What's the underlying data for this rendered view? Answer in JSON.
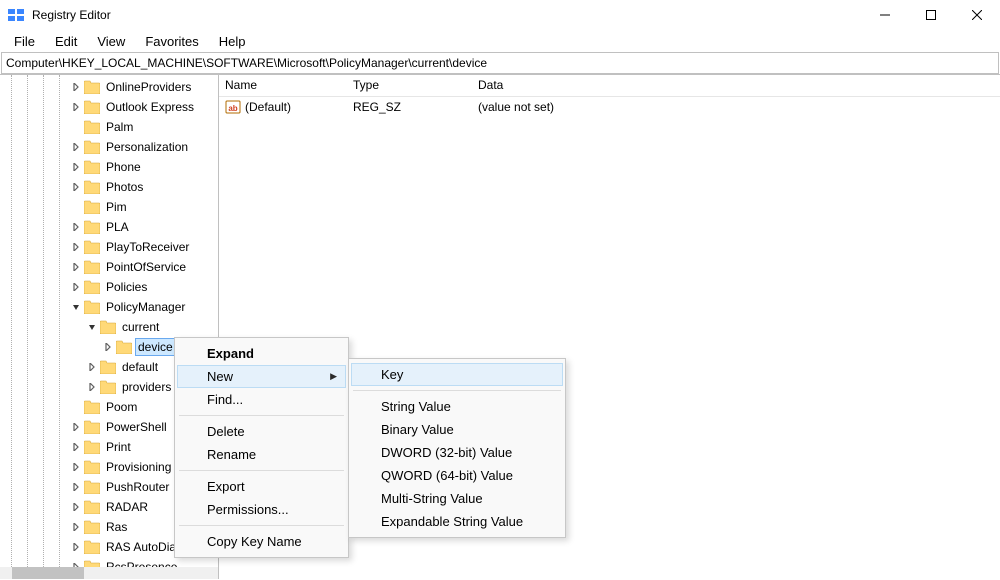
{
  "window": {
    "title": "Registry Editor"
  },
  "menu": {
    "file": "File",
    "edit": "Edit",
    "view": "View",
    "favorites": "Favorites",
    "help": "Help"
  },
  "address": "Computer\\HKEY_LOCAL_MACHINE\\SOFTWARE\\Microsoft\\PolicyManager\\current\\device",
  "list": {
    "columns": {
      "name": "Name",
      "type": "Type",
      "data": "Data"
    },
    "rows": [
      {
        "name": "(Default)",
        "type": "REG_SZ",
        "data": "(value not set)"
      }
    ]
  },
  "tree": {
    "items": [
      {
        "depth": 4,
        "label": "OnlineProviders",
        "tw": ">"
      },
      {
        "depth": 4,
        "label": "Outlook Express",
        "tw": ">"
      },
      {
        "depth": 4,
        "label": "Palm",
        "tw": ""
      },
      {
        "depth": 4,
        "label": "Personalization",
        "tw": ">"
      },
      {
        "depth": 4,
        "label": "Phone",
        "tw": ">"
      },
      {
        "depth": 4,
        "label": "Photos",
        "tw": ">"
      },
      {
        "depth": 4,
        "label": "Pim",
        "tw": ""
      },
      {
        "depth": 4,
        "label": "PLA",
        "tw": ">"
      },
      {
        "depth": 4,
        "label": "PlayToReceiver",
        "tw": ">"
      },
      {
        "depth": 4,
        "label": "PointOfService",
        "tw": ">"
      },
      {
        "depth": 4,
        "label": "Policies",
        "tw": ">"
      },
      {
        "depth": 4,
        "label": "PolicyManager",
        "tw": "v"
      },
      {
        "depth": 5,
        "label": "current",
        "tw": "v"
      },
      {
        "depth": 6,
        "label": "device",
        "tw": ">",
        "selected": true
      },
      {
        "depth": 5,
        "label": "default",
        "tw": ">"
      },
      {
        "depth": 5,
        "label": "providers",
        "tw": ">"
      },
      {
        "depth": 4,
        "label": "Poom",
        "tw": ""
      },
      {
        "depth": 4,
        "label": "PowerShell",
        "tw": ">"
      },
      {
        "depth": 4,
        "label": "Print",
        "tw": ">"
      },
      {
        "depth": 4,
        "label": "Provisioning",
        "tw": ">"
      },
      {
        "depth": 4,
        "label": "PushRouter",
        "tw": ">"
      },
      {
        "depth": 4,
        "label": "RADAR",
        "tw": ">"
      },
      {
        "depth": 4,
        "label": "Ras",
        "tw": ">"
      },
      {
        "depth": 4,
        "label": "RAS AutoDial",
        "tw": ">"
      },
      {
        "depth": 4,
        "label": "RcsPresence",
        "tw": ">"
      }
    ]
  },
  "context1": {
    "expand": "Expand",
    "new": "New",
    "find": "Find...",
    "delete": "Delete",
    "rename": "Rename",
    "export": "Export",
    "permissions": "Permissions...",
    "copy_key_name": "Copy Key Name"
  },
  "context2": {
    "key": "Key",
    "string_value": "String Value",
    "binary_value": "Binary Value",
    "dword_value": "DWORD (32-bit) Value",
    "qword_value": "QWORD (64-bit) Value",
    "multi_string_value": "Multi-String Value",
    "expandable_string_value": "Expandable String Value"
  }
}
